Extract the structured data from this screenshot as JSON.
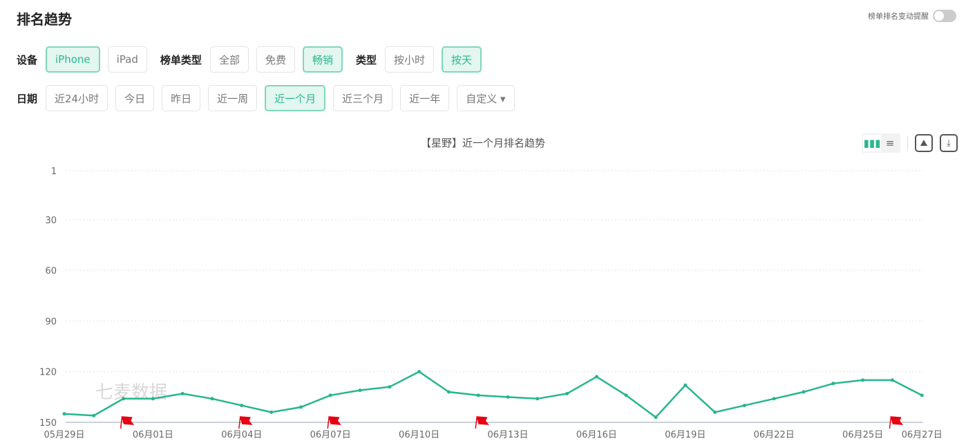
{
  "header": {
    "title": "排名趋势",
    "alert_label": "榜单排名变动提醒",
    "alert_enabled": false
  },
  "filters": {
    "device": {
      "label": "设备",
      "options": [
        "iPhone",
        "iPad"
      ],
      "selected": "iPhone"
    },
    "list_type": {
      "label": "榜单类型",
      "options": [
        "全部",
        "免费",
        "畅销"
      ],
      "selected": "畅销"
    },
    "type": {
      "label": "类型",
      "options": [
        "按小时",
        "按天"
      ],
      "selected": "按天"
    },
    "date": {
      "label": "日期",
      "options": [
        "近24小时",
        "今日",
        "昨日",
        "近一周",
        "近一个月",
        "近三个月",
        "近一年",
        "自定义 ▾"
      ],
      "selected": "近一个月"
    }
  },
  "chart_toolbar": {
    "icons": [
      "bar-view-icon",
      "list-view-icon",
      "image-icon",
      "download-icon"
    ]
  },
  "watermark": "七麦数据",
  "colors": {
    "accent": "#2bb88f",
    "line": "#26b68c",
    "flag": "#e60012"
  },
  "chart_data": {
    "type": "line",
    "title": "【星野】近一个月排名趋势",
    "y_reversed": true,
    "ylim": [
      1,
      150
    ],
    "yticks": [
      1,
      30,
      60,
      90,
      120,
      150
    ],
    "x": [
      "05月29日",
      "05月30日",
      "05月31日",
      "06月01日",
      "06月02日",
      "06月03日",
      "06月04日",
      "06月05日",
      "06月06日",
      "06月07日",
      "06月08日",
      "06月09日",
      "06月10日",
      "06月11日",
      "06月12日",
      "06月13日",
      "06月14日",
      "06月15日",
      "06月16日",
      "06月17日",
      "06月18日",
      "06月19日",
      "06月20日",
      "06月21日",
      "06月22日",
      "06月23日",
      "06月24日",
      "06月25日",
      "06月26日",
      "06月27日"
    ],
    "xticks": [
      "05月29日",
      "06月01日",
      "06月04日",
      "06月07日",
      "06月10日",
      "06月13日",
      "06月16日",
      "06月19日",
      "06月22日",
      "06月25日",
      "06月27日"
    ],
    "series": [
      {
        "name": "畅销",
        "values": [
          145,
          146,
          136,
          136,
          133,
          136,
          140,
          144,
          141,
          134,
          131,
          129,
          120,
          132,
          134,
          135,
          136,
          133,
          123,
          134,
          147,
          128,
          144,
          140,
          136,
          132,
          127,
          125,
          125,
          134
        ]
      }
    ],
    "flags": [
      "05月31日",
      "06月04日",
      "06月07日",
      "06月12日",
      "06月26日"
    ],
    "grid": true
  }
}
